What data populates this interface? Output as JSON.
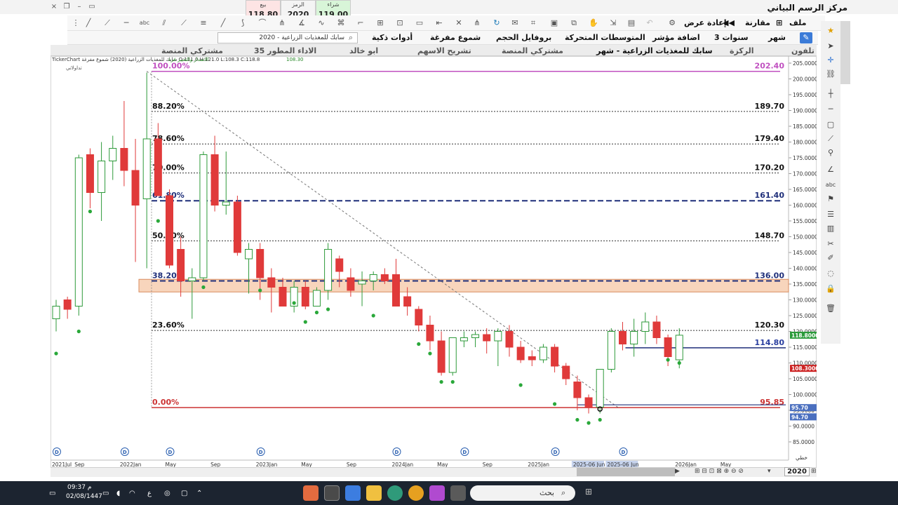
{
  "window": {
    "title": "مركز الرسم البياني",
    "controls": [
      "×",
      "❐",
      "–",
      "▭"
    ]
  },
  "quote": {
    "bid_label": "بيع",
    "bid_value": "118.80",
    "symbol_label": "الرمز",
    "symbol_value": "2020",
    "ask_label": "شراء",
    "ask_value": "119.00"
  },
  "toolbar1": {
    "menus": [
      "ملف",
      "مقارنة",
      "إعادة عرض"
    ]
  },
  "toolbar2": {
    "search_value": "2020 - سابك للمغذيات الزراعية",
    "items": [
      "شهر",
      "3 سنوات",
      "اضافة مؤشر",
      "المتوسطات المتحركة",
      "بروفايل الحجم",
      "شموع مفرغة",
      "أدوات ذكية"
    ]
  },
  "tabs": [
    "تلفون",
    "الركزة",
    "سابك للمغذيات الزراعية - شهر",
    "مشتركي المنصة",
    "تشريح الاسهم",
    "ابو خالد",
    "الاداء المطور 35",
    "مشتركي المنصة"
  ],
  "chart_header": {
    "ticker": "TickerChart سابك للمغذيات الزراعية (2020) شموع مفرغة  O:111.0  H:121.0  L:108.3  C:118.8",
    "sub": "تداولاتي",
    "indicator_label": "الاصدار والتغيير فرة",
    "indicator_value": "108.30"
  },
  "chart_data": {
    "type": "candlestick",
    "ylim": [
      85,
      205
    ],
    "y_ticks": [
      85,
      90,
      95,
      100,
      105,
      110,
      115,
      120,
      125,
      130,
      135,
      140,
      145,
      150,
      155,
      160,
      165,
      170,
      175,
      180,
      185,
      190,
      195,
      200,
      205
    ],
    "y_tick_labels": [
      "85.0000",
      "90.0000",
      "95.0000",
      "100.0000",
      "105.0000",
      "110.0000",
      "115.0000",
      "120.0000",
      "125.0000",
      "130.0000",
      "135.0000",
      "140.0000",
      "145.0000",
      "150.0000",
      "155.0000",
      "160.0000",
      "165.0000",
      "170.0000",
      "175.0000",
      "180.0000",
      "185.0000",
      "190.0000",
      "195.0000",
      "200.0000",
      "205.0000"
    ],
    "x_labels": [
      "2021Jul",
      "Sep",
      "2022Jan",
      "May",
      "Sep",
      "2023Jan",
      "May",
      "Sep",
      "2024Jan",
      "May",
      "Sep",
      "2025Jan",
      "2025-06 Jun",
      "2025-06 Jun",
      "2026Jan",
      "May"
    ],
    "x_label_candle_index": [
      0,
      2,
      6,
      10,
      14,
      18,
      22,
      26,
      30,
      34,
      38,
      42,
      46,
      49,
      55,
      59
    ],
    "candles": [
      {
        "o": 124,
        "h": 130,
        "l": 120,
        "c": 128
      },
      {
        "o": 130,
        "h": 131,
        "l": 124,
        "c": 127
      },
      {
        "o": 128,
        "h": 176,
        "l": 125,
        "c": 175
      },
      {
        "o": 176,
        "h": 178,
        "l": 159,
        "c": 164
      },
      {
        "o": 164,
        "h": 180,
        "l": 155,
        "c": 174
      },
      {
        "o": 174,
        "h": 182,
        "l": 168,
        "c": 178
      },
      {
        "o": 178,
        "h": 193,
        "l": 166,
        "c": 171
      },
      {
        "o": 171,
        "h": 181,
        "l": 142,
        "c": 160
      },
      {
        "o": 162,
        "h": 202,
        "l": 140,
        "c": 181
      },
      {
        "o": 181,
        "h": 186,
        "l": 164,
        "c": 163
      },
      {
        "o": 163,
        "h": 165,
        "l": 140,
        "c": 141
      },
      {
        "o": 146,
        "h": 150,
        "l": 131,
        "c": 136
      },
      {
        "o": 136,
        "h": 140,
        "l": 124,
        "c": 137
      },
      {
        "o": 137,
        "h": 177,
        "l": 136,
        "c": 176
      },
      {
        "o": 176,
        "h": 182,
        "l": 158,
        "c": 160
      },
      {
        "o": 160,
        "h": 177,
        "l": 157,
        "c": 161
      },
      {
        "o": 161,
        "h": 163,
        "l": 144,
        "c": 145
      },
      {
        "o": 143,
        "h": 148,
        "l": 132,
        "c": 146
      },
      {
        "o": 146,
        "h": 148,
        "l": 130,
        "c": 137
      },
      {
        "o": 137,
        "h": 140,
        "l": 126,
        "c": 134
      },
      {
        "o": 134,
        "h": 137,
        "l": 128,
        "c": 128
      },
      {
        "o": 128,
        "h": 136,
        "l": 126,
        "c": 134
      },
      {
        "o": 134,
        "h": 136,
        "l": 127,
        "c": 128
      },
      {
        "o": 128,
        "h": 134,
        "l": 129,
        "c": 133
      },
      {
        "o": 133,
        "h": 148,
        "l": 130,
        "c": 146
      },
      {
        "o": 143,
        "h": 144,
        "l": 134,
        "c": 139
      },
      {
        "o": 137,
        "h": 140,
        "l": 131,
        "c": 133
      },
      {
        "o": 135,
        "h": 139,
        "l": 128,
        "c": 136
      },
      {
        "o": 136,
        "h": 139,
        "l": 133,
        "c": 138
      },
      {
        "o": 138,
        "h": 140,
        "l": 135,
        "c": 136
      },
      {
        "o": 138,
        "h": 143,
        "l": 128,
        "c": 128
      },
      {
        "o": 131,
        "h": 134,
        "l": 125,
        "c": 128
      },
      {
        "o": 127,
        "h": 128,
        "l": 120,
        "c": 122
      },
      {
        "o": 122,
        "h": 125,
        "l": 114,
        "c": 117
      },
      {
        "o": 117,
        "h": 120,
        "l": 106,
        "c": 107
      },
      {
        "o": 107,
        "h": 118,
        "l": 106,
        "c": 118
      },
      {
        "o": 117,
        "h": 120,
        "l": 115,
        "c": 118
      },
      {
        "o": 118,
        "h": 120,
        "l": 115,
        "c": 119
      },
      {
        "o": 119,
        "h": 121,
        "l": 113,
        "c": 117
      },
      {
        "o": 117,
        "h": 121,
        "l": 109,
        "c": 120
      },
      {
        "o": 120,
        "h": 122,
        "l": 112,
        "c": 115
      },
      {
        "o": 115,
        "h": 117,
        "l": 110,
        "c": 111
      },
      {
        "o": 112,
        "h": 114,
        "l": 109,
        "c": 111
      },
      {
        "o": 111,
        "h": 116,
        "l": 110,
        "c": 115
      },
      {
        "o": 115,
        "h": 116,
        "l": 107,
        "c": 109
      },
      {
        "o": 109,
        "h": 110,
        "l": 103,
        "c": 105
      },
      {
        "o": 104,
        "h": 106,
        "l": 95,
        "c": 99
      },
      {
        "o": 99,
        "h": 100,
        "l": 94,
        "c": 96
      },
      {
        "o": 96,
        "h": 108,
        "l": 94,
        "c": 108
      },
      {
        "o": 108,
        "h": 121,
        "l": 107,
        "c": 120
      },
      {
        "o": 120,
        "h": 123,
        "l": 114,
        "c": 116
      },
      {
        "o": 116,
        "h": 124,
        "l": 112,
        "c": 120
      },
      {
        "o": 120,
        "h": 126,
        "l": 116,
        "c": 123
      },
      {
        "o": 123,
        "h": 125,
        "l": 116,
        "c": 118
      },
      {
        "o": 118,
        "h": 119,
        "l": 109,
        "c": 112
      },
      {
        "o": 111,
        "h": 121,
        "l": 108.3,
        "c": 118.8
      }
    ],
    "dots": [
      {
        "i": 0,
        "y": 113
      },
      {
        "i": 2,
        "y": 120
      },
      {
        "i": 3,
        "y": 158
      },
      {
        "i": 9,
        "y": 155
      },
      {
        "i": 13,
        "y": 134
      },
      {
        "i": 18,
        "y": 133
      },
      {
        "i": 21,
        "y": 129
      },
      {
        "i": 22,
        "y": 123
      },
      {
        "i": 23,
        "y": 126
      },
      {
        "i": 24,
        "y": 127
      },
      {
        "i": 28,
        "y": 125
      },
      {
        "i": 32,
        "y": 116
      },
      {
        "i": 33,
        "y": 113
      },
      {
        "i": 34,
        "y": 104
      },
      {
        "i": 35,
        "y": 104
      },
      {
        "i": 41,
        "y": 103
      },
      {
        "i": 44,
        "y": 97
      },
      {
        "i": 46,
        "y": 92
      },
      {
        "i": 47,
        "y": 91
      },
      {
        "i": 48,
        "y": 92
      },
      {
        "i": 54,
        "y": 111
      },
      {
        "i": 55,
        "y": 110
      }
    ],
    "d_markers": [
      0,
      6,
      10,
      18,
      30,
      36,
      44,
      50
    ],
    "fib_levels": [
      {
        "label": "100.00%",
        "value": 202.4,
        "value_label": "202.40",
        "color": "#c050c0",
        "style": "solid"
      },
      {
        "label": "88.20%",
        "value": 189.7,
        "value_label": "189.70",
        "color": "#333333",
        "style": "dotted"
      },
      {
        "label": "78.60%",
        "value": 179.4,
        "value_label": "179.40",
        "color": "#333333",
        "style": "dotted"
      },
      {
        "label": "70.00%",
        "value": 170.2,
        "value_label": "170.20",
        "color": "#333333",
        "style": "dotted"
      },
      {
        "label": "61.80%",
        "value": 161.4,
        "value_label": "161.40",
        "color": "#1f2f7a",
        "style": "dashed"
      },
      {
        "label": "50.00%",
        "value": 148.7,
        "value_label": "148.70",
        "color": "#333333",
        "style": "dotted"
      },
      {
        "label": "38.20%",
        "value": 136.0,
        "value_label": "136.00",
        "color": "#1f2f7a",
        "style": "dashed"
      },
      {
        "label": "23.60%",
        "value": 120.3,
        "value_label": "120.30",
        "color": "#333333",
        "style": "dotted"
      },
      {
        "label": "0.00%",
        "value": 95.85,
        "value_label": "95.85",
        "color": "#cc3333",
        "style": "solid"
      }
    ],
    "zone": {
      "from": 132.5,
      "to": 136.5,
      "color": "#f6c7a5"
    },
    "hline": {
      "value": 114.8,
      "value_label": "114.80",
      "color": "#1f2f7a",
      "from_candle": 50
    },
    "trendline": {
      "from_candle": 8,
      "from_value": 202.4,
      "to_candle": 49,
      "to_value": 95.85
    },
    "price_tags": [
      {
        "value": 118.8,
        "label": "118.8000",
        "color": "#2a9a3a"
      },
      {
        "value": 108.3,
        "label": "108.3000",
        "color": "#cc2222"
      },
      {
        "value": 95.85,
        "label": "95.70",
        "color": "#4a6fbf"
      },
      {
        "value": 94.7,
        "label": "94.70",
        "color": "#4a6fbf"
      }
    ],
    "grid": false,
    "up_color": "#2e9a3a",
    "down_color": "#e03a3a"
  },
  "footer": {
    "year": "2020",
    "corner": "خطي"
  },
  "taskbar": {
    "search": "بحث",
    "time": "09:37 م",
    "date": "02/08/1447",
    "lang": "ع"
  }
}
